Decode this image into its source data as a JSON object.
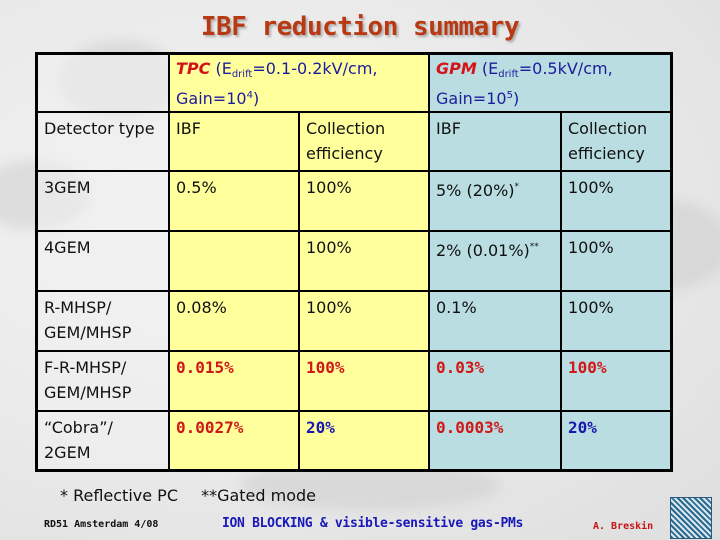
{
  "title": "IBF reduction summary",
  "table": {
    "header": {
      "tpc": {
        "keyword": "TPC",
        "open": " (E",
        "sub": "drift",
        "rest": "=0.1-0.2kV/cm,",
        "gain_prefix": "Gain=10",
        "gain_exp": "4",
        "close": ")"
      },
      "gpm": {
        "keyword": "GPM",
        "open": " (E",
        "sub": "drift",
        "rest": "=0.5kV/cm,",
        "gain_prefix": "Gain=10",
        "gain_exp": "5",
        "close": ")"
      }
    },
    "subheader": {
      "detector_type": "Detector type",
      "tpc_ibf": "IBF",
      "tpc_collection": "Collection efficiency",
      "gpm_ibf": "IBF",
      "gpm_collection": "Collection efficiency"
    },
    "rows": [
      {
        "detector": "3GEM",
        "tpc_ibf": "0.5%",
        "tpc_coll": "100%",
        "gpm_ibf": "5% (20%)",
        "gpm_ibf_mark": "*",
        "gpm_coll": "100%"
      },
      {
        "detector": "4GEM",
        "tpc_ibf": "",
        "tpc_coll": "100%",
        "gpm_ibf": "2% (0.01%)",
        "gpm_ibf_mark": "**",
        "gpm_coll": "100%"
      },
      {
        "detector": "R-MHSP/ GEM/MHSP",
        "tpc_ibf": "0.08%",
        "tpc_coll": "100%",
        "gpm_ibf": "0.1%",
        "gpm_ibf_mark": "",
        "gpm_coll": "100%"
      },
      {
        "detector": "F-R-MHSP/ GEM/MHSP",
        "tpc_ibf": "0.015%",
        "tpc_coll": "100%",
        "gpm_ibf": "0.03%",
        "gpm_ibf_mark": "",
        "gpm_coll": "100%"
      },
      {
        "detector": "“Cobra”/ 2GEM",
        "tpc_ibf": "0.0027%",
        "tpc_coll": "20%",
        "gpm_ibf": "0.0003%",
        "gpm_ibf_mark": "",
        "gpm_coll": "20%"
      }
    ]
  },
  "footnotes": {
    "reflective": "* Reflective PC",
    "gated": "**Gated mode"
  },
  "footer": {
    "left": "RD51 Amsterdam 4/08",
    "center": "ION BLOCKING & visible-sensitive gas-PMs",
    "right": "A. Breskin"
  },
  "colors": {
    "title": "#b83a14",
    "tpc_bg": "#ffff9c",
    "gpm_bg": "#b9dde0",
    "highlight_red": "#d01818",
    "highlight_blue": "#1818b0"
  }
}
